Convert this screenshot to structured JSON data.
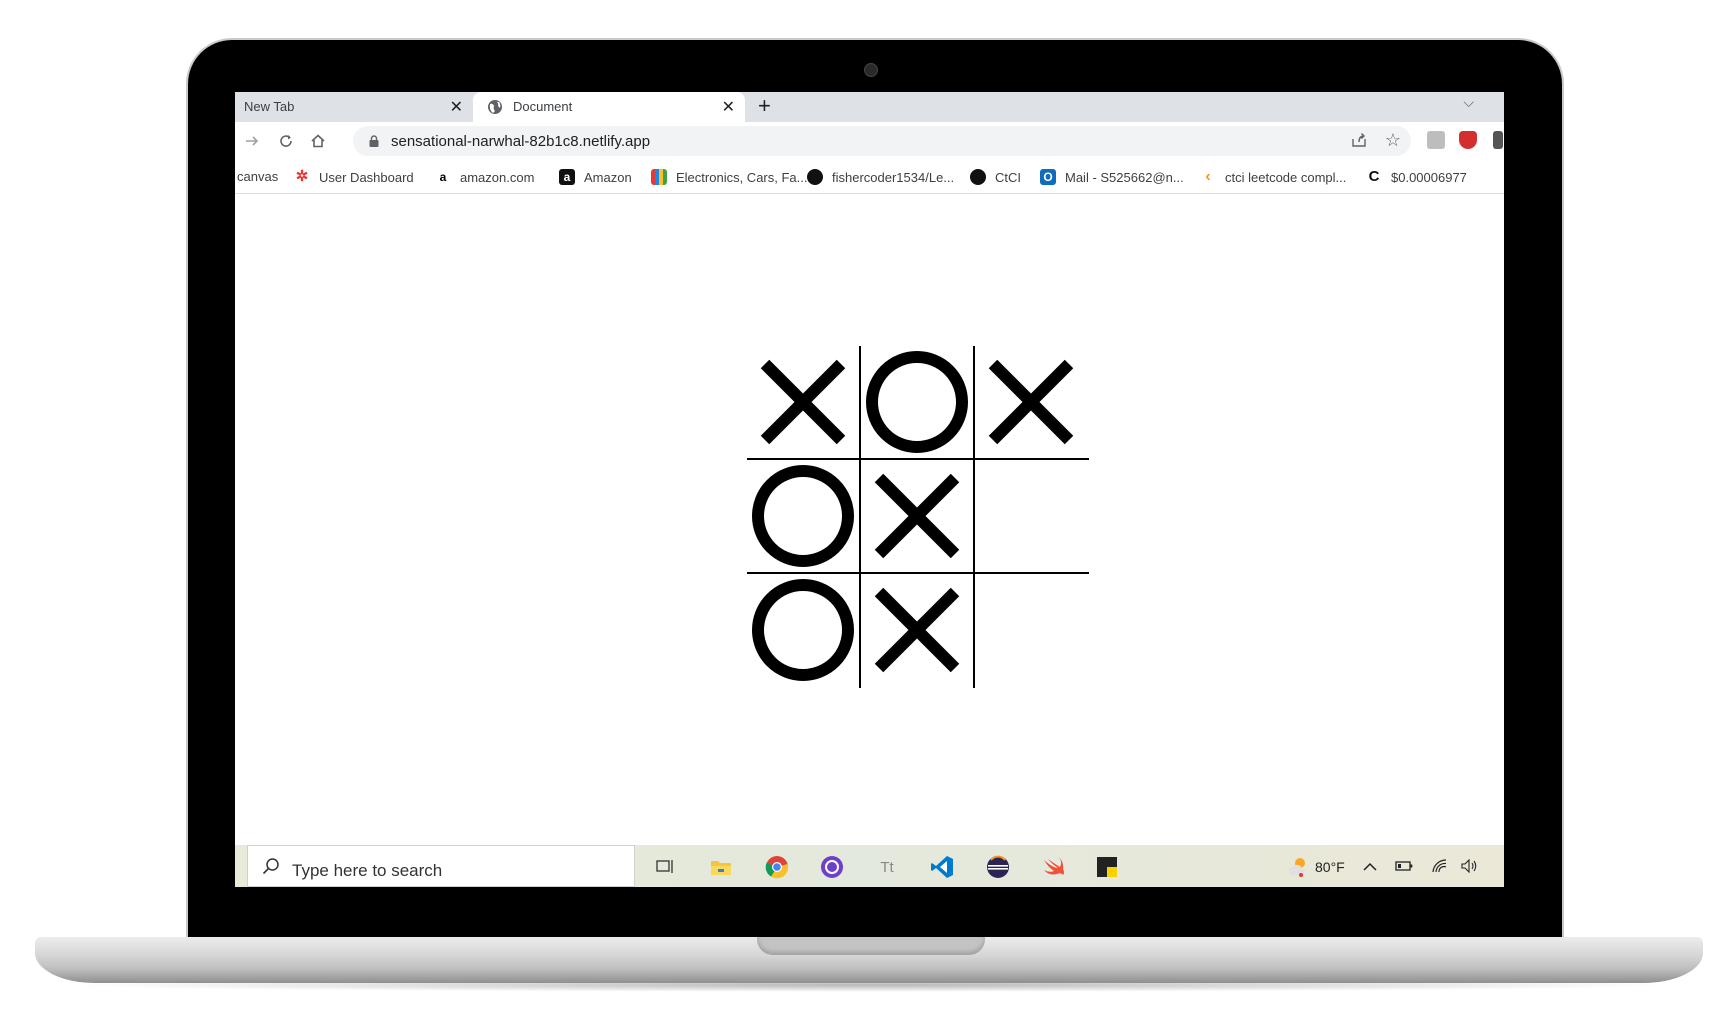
{
  "browser": {
    "tabs": [
      {
        "title": "New Tab",
        "close": "✕"
      },
      {
        "title": "Document",
        "close": "✕"
      }
    ],
    "new_tab": "+",
    "tab_search": "⌵",
    "url": "sensational-narwhal-82b1c8.netlify.app",
    "bookmarks": [
      {
        "label": "canvas",
        "icon": ""
      },
      {
        "label": "User Dashboard",
        "icon": "✲"
      },
      {
        "label": "amazon.com",
        "icon": "a"
      },
      {
        "label": "Amazon",
        "icon": "a"
      },
      {
        "label": "Electronics, Cars, Fa...",
        "icon": ""
      },
      {
        "label": "fishercoder1534/Le...",
        "icon": ""
      },
      {
        "label": "CtCI",
        "icon": ""
      },
      {
        "label": "Mail - S525662@n...",
        "icon": "O"
      },
      {
        "label": "ctci leetcode compl...",
        "icon": "‹"
      },
      {
        "label": "$0.00006977",
        "icon": "C"
      }
    ]
  },
  "game": {
    "board": [
      "X",
      "O",
      "X",
      "O",
      "X",
      "",
      "O",
      "X",
      ""
    ]
  },
  "taskbar": {
    "search_placeholder": "Type here to search",
    "temperature": "80°F"
  }
}
